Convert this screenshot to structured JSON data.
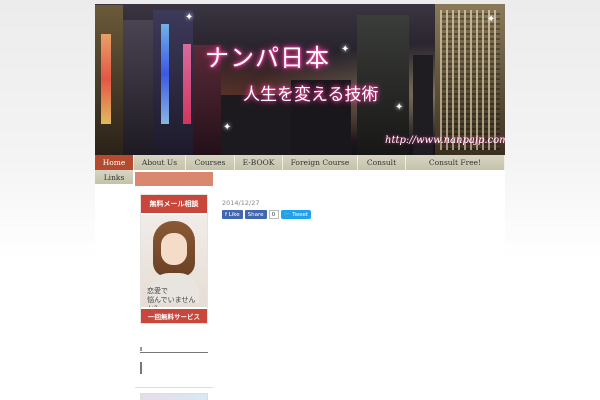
{
  "header": {
    "title": "ナンパ日本",
    "subtitle": "人生を変える技術",
    "url": "http://www.nanpajp.com"
  },
  "nav": {
    "items": [
      {
        "label": "Home",
        "active": true
      },
      {
        "label": "About Us"
      },
      {
        "label": "Courses"
      },
      {
        "label": "E-BOOK"
      },
      {
        "label": "Foreign Course"
      },
      {
        "label": "Consult"
      },
      {
        "label": "Consult Free!"
      }
    ],
    "second_row": [
      {
        "label": "Links"
      }
    ]
  },
  "sidebar": {
    "banner": {
      "head": "無料メール相談",
      "caption_line1": "恋愛で",
      "caption_line2": "悩んでいませんか？",
      "foot": "一回無料サービス"
    }
  },
  "post": {
    "date": "2014/12/27",
    "like_label": "Like",
    "share_label": "Share",
    "like_count": "0",
    "tweet_label": "Tweet"
  },
  "colors": {
    "nav_active": "#b44a2e",
    "nav_bg": "#d0cfb8",
    "sidebar_red": "#c8463a",
    "sidebar_bar": "#d9876f"
  }
}
